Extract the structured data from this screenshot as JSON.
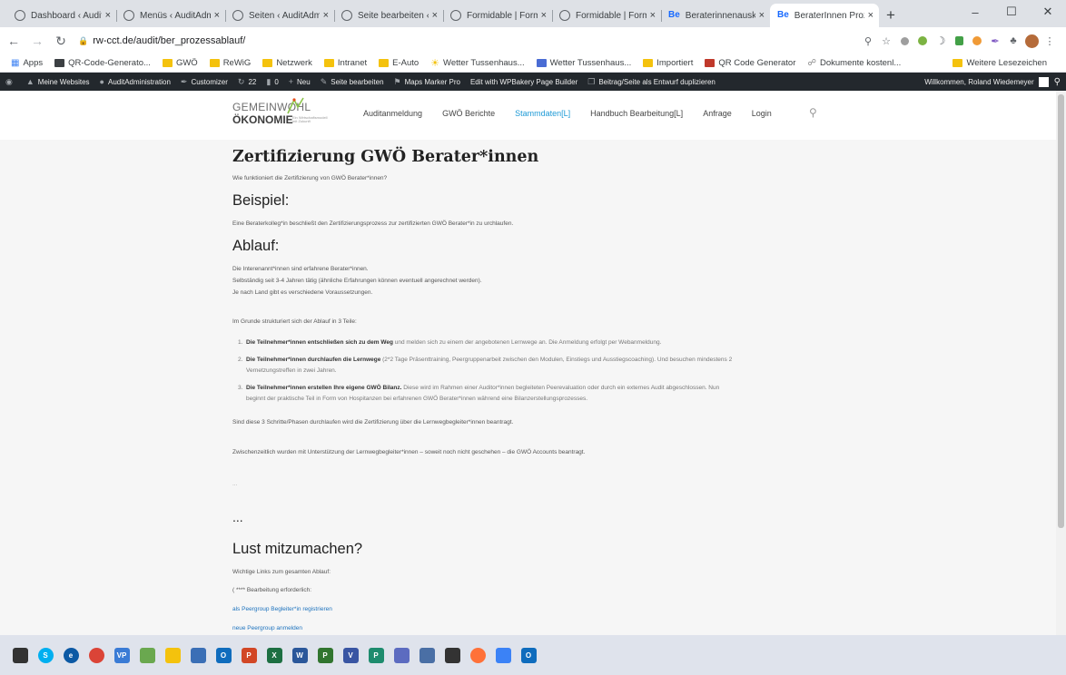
{
  "browser": {
    "tabs": [
      {
        "title": "Dashboard ‹ AuditAdministration",
        "icon": "wordpress-icon"
      },
      {
        "title": "Menüs ‹ AuditAdministration",
        "icon": "wordpress-icon"
      },
      {
        "title": "Seiten ‹ AuditAdministration",
        "icon": "wordpress-icon"
      },
      {
        "title": "Seite bearbeiten ‹ AuditAdministration",
        "icon": "wordpress-icon"
      },
      {
        "title": "Formidable | Formulare",
        "icon": "wordpress-icon"
      },
      {
        "title": "Formidable | Formulare",
        "icon": "wordpress-icon"
      },
      {
        "title": "Beraterinnenauskunft",
        "icon": "behance-icon",
        "icon_text": "Be"
      },
      {
        "title": "BeraterInnen Prozess",
        "icon": "behance-icon",
        "icon_text": "Be",
        "active": true
      }
    ],
    "tab_close": "×",
    "new_tab": "+",
    "window_controls": [
      "–",
      "☐",
      "✕"
    ],
    "url": "rw-cct.de/audit/ber_prozessablauf/"
  },
  "bookmarks": {
    "items": [
      {
        "label": "Apps",
        "icon": "apps-grid-icon"
      },
      {
        "label": "QR-Code-Generato...",
        "icon": "qr-icon"
      },
      {
        "label": "GWÖ",
        "icon": "folder-icon"
      },
      {
        "label": "ReWiG",
        "icon": "folder-icon"
      },
      {
        "label": "Netzwerk",
        "icon": "folder-icon"
      },
      {
        "label": "Intranet",
        "icon": "folder-icon"
      },
      {
        "label": "E-Auto",
        "icon": "folder-icon"
      },
      {
        "label": "Wetter Tussenhaus...",
        "icon": "sun-icon"
      },
      {
        "label": "Wetter Tussenhaus...",
        "icon": "weather-site-icon"
      },
      {
        "label": "Importiert",
        "icon": "folder-icon"
      },
      {
        "label": "QR Code Generator",
        "icon": "qr-icon"
      },
      {
        "label": "Dokumente kostenl...",
        "icon": "document-icon"
      }
    ],
    "other": "Weitere Lesezeichen"
  },
  "adminbar": {
    "items": [
      "Meine Websites",
      "AuditAdministration",
      "Customizer",
      "22",
      "0",
      "Neu",
      "Seite bearbeiten",
      "Maps Marker Pro",
      "Edit with WPBakery Page Builder",
      "Beitrag/Seite als Entwurf duplizieren"
    ],
    "greeting": "Willkommen, Roland Wiedemeyer"
  },
  "site": {
    "logo": {
      "line1": "GEMEINWOHL",
      "line2": "ÖKONOMIE",
      "tagline": "Ein Wirtschaftsmodell mit Zukunft"
    },
    "menu": [
      "Auditanmeldung",
      "GWÖ Berichte",
      "Stammdaten[L]",
      "Handbuch Bearbeitung[L]",
      "Anfrage",
      "Login"
    ],
    "active_menu": "Stammdaten[L]"
  },
  "page": {
    "title": "Zertifizierung GWÖ Berater*innen",
    "intro": "Wie funktioniert die Zertifizierung von GWÖ Berater*innen?",
    "h_beispiel": "Beispiel:",
    "beispiel_text": "Eine Beraterkolleg*in beschließt den Zertifizierungsprozess zur zertifizierten GWÖ Berater*in zu urchlaufen.",
    "h_ablauf": "Ablauf:",
    "ablauf_lines": [
      "Die Interenannt*innen sind erfahrene Berater*innen.",
      "Selbständig seit 3-4 Jahren tätig (ähnliche Erfahrungen können eventuell angerechnet werden).",
      "Je nach Land gibt es verschiedene Voraussetzungen."
    ],
    "struktur": "Im Grunde strukturiert sich der Ablauf in 3 Teile:",
    "steps": [
      {
        "num": "1.",
        "bold": "Die Teilnehmer*innen entschließen sich zu dem Weg",
        "rest": " und melden sich zu einem der angebotenen Lernwege an. Die Anmeldung erfolgt per Webanmeldung.",
        "line2": ""
      },
      {
        "num": "2.",
        "bold": "Die Teilnehmer*innen durchlaufen die Lernwege",
        "rest": " (2*2 Tage Präsenttraining, Peergruppenarbeit zwischen den Modulen, Einstiegs und Ausstiegscoaching). Und besuchen mindestens 2",
        "line2": "Vernetzungstreffen in zwei Jahren."
      },
      {
        "num": "3.",
        "bold": "Die Teilnehmer*innen erstellen Ihre eigene GWÖ Bilanz.",
        "rest": " Diese wird im Rahmen einer Auditor*innen begleiteten Peerevaluation oder durch ein externes Audit abgeschlossen. Nun",
        "line2": "beginnt der praktische Teil in Form von Hospitanzen bei erfahrenen GWÖ Berater*innen während eine Bilanzerstellungsprozesses."
      }
    ],
    "schritte": "Sind diese 3 Schritte/Phasen durchlaufen wird die Zertifizierung über die Lernwegbegleiter*innen beantragt.",
    "zwischen": "Zwischenzeitlich wurden mit Unterstützung der Lernwegbegleiter*innen – soweit noch nicht geschehen – die GWÖ Accounts beantragt.",
    "small_ellipsis": "...",
    "big_ellipsis": "...",
    "h_lust": "Lust mitzumachen?",
    "links_intro": "Wichtige Links zum gesamten Ablauf:",
    "note": "( **** Bearbeitung erforderlich:",
    "link1": "als Peergroup Begleiter*in registrieren",
    "link2": "neue Peergroup anmelden"
  },
  "colors": {
    "accent_link": "#1e73be",
    "menu_active": "#1e9ad6",
    "adminbar": "#23282d"
  },
  "taskbar": {
    "items": [
      {
        "name": "task-view-icon",
        "label": "",
        "color": "#333333"
      },
      {
        "name": "skype-icon",
        "label": "S",
        "color": "#00aff0"
      },
      {
        "name": "edge-icon",
        "label": "e",
        "color": "#0c59a4"
      },
      {
        "name": "chrome-icon",
        "label": "",
        "color": "#db4437"
      },
      {
        "name": "visual-paradigm-icon",
        "label": "VP",
        "color": "#3a7bd5"
      },
      {
        "name": "publisher-icon",
        "label": "",
        "color": "#6aa84f"
      },
      {
        "name": "file-explorer-icon",
        "label": "",
        "color": "#f4c20d"
      },
      {
        "name": "notepad-icon",
        "label": "",
        "color": "#3b6fb6"
      },
      {
        "name": "outlook-icon",
        "label": "O",
        "color": "#0f6cbd"
      },
      {
        "name": "powerpoint-icon",
        "label": "P",
        "color": "#d24726"
      },
      {
        "name": "excel-icon",
        "label": "X",
        "color": "#1d6f42"
      },
      {
        "name": "word-icon",
        "label": "W",
        "color": "#2b579a"
      },
      {
        "name": "project-icon",
        "label": "P",
        "color": "#31752f"
      },
      {
        "name": "visio-icon",
        "label": "V",
        "color": "#3955a3"
      },
      {
        "name": "planner-icon",
        "label": "P",
        "color": "#1e8c6e"
      },
      {
        "name": "connect-icon",
        "label": "",
        "color": "#5c6bc0"
      },
      {
        "name": "snipping-tool-icon",
        "label": "",
        "color": "#4a6fa5"
      },
      {
        "name": "monitor-icon",
        "label": "",
        "color": "#333333"
      },
      {
        "name": "firefox-icon",
        "label": "",
        "color": "#ff7139"
      },
      {
        "name": "teams-meeting-icon",
        "label": "",
        "color": "#3b82f6"
      },
      {
        "name": "outlook-2-icon",
        "label": "O",
        "color": "#0f6cbd"
      }
    ]
  }
}
